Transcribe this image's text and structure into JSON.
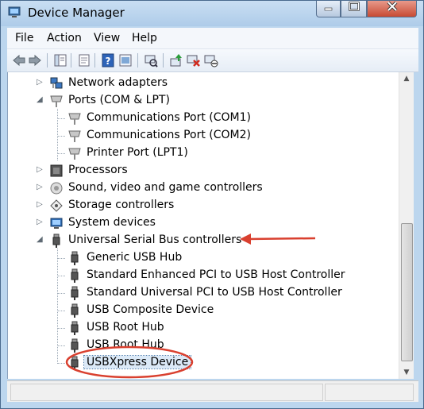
{
  "window": {
    "title": "Device Manager"
  },
  "colors": {
    "annotation": "#d9402f"
  },
  "menu": [
    "File",
    "Action",
    "View",
    "Help"
  ],
  "toolbar_icons": [
    "back-arrow-icon",
    "forward-arrow-icon",
    "show-hide-tree-icon",
    "properties-icon",
    "help-icon",
    "scan-hardware-icon",
    "update-driver-icon",
    "uninstall-icon",
    "disable-device-icon"
  ],
  "tree": {
    "network_adapters": "Network adapters",
    "ports": "Ports (COM & LPT)",
    "com1": "Communications Port (COM1)",
    "com2": "Communications Port (COM2)",
    "lpt1": "Printer Port (LPT1)",
    "processors": "Processors",
    "sound": "Sound, video and game controllers",
    "storage": "Storage controllers",
    "system": "System devices",
    "usb": "Universal Serial Bus controllers",
    "usb_items": [
      "Generic USB Hub",
      "Standard Enhanced PCI to USB Host Controller",
      "Standard Universal PCI to USB Host Controller",
      "USB Composite Device",
      "USB Root Hub",
      "USB Root Hub",
      "USBXpress Device"
    ]
  }
}
